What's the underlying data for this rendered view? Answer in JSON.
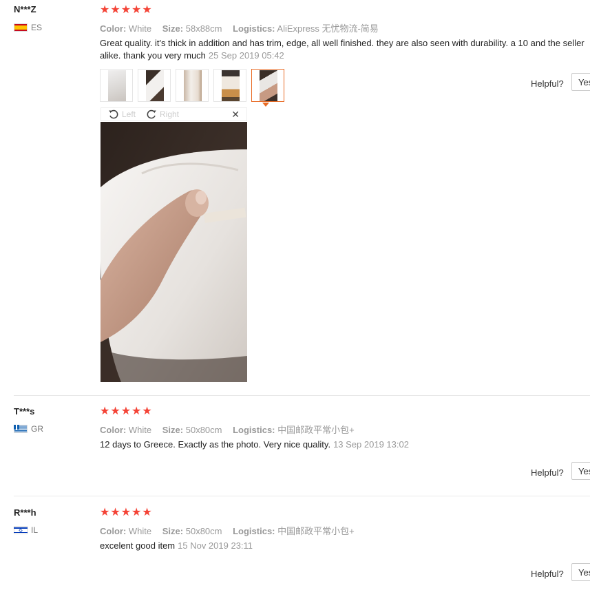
{
  "labels": {
    "color": "Color:",
    "size": "Size:",
    "logistics": "Logistics:",
    "helpful": "Helpful?",
    "yes": "Yes"
  },
  "stars_display": "★★★★★",
  "reviews": [
    {
      "user": "N***Z",
      "country": "ES",
      "rating": 5,
      "color": "White",
      "size": "58x88cm",
      "logistics": "AliExpress 无忧物流-简易",
      "text": "Great quality. it's thick in addition and has trim, edge, all well finished. they are also seen with durability. a 10 and the seller alike. thank you very much",
      "date": "25 Sep 2019 05:42",
      "photo_count": 5,
      "active_photo": 5,
      "viewer": {
        "left": "Left",
        "right": "Right"
      }
    },
    {
      "user": "T***s",
      "country": "GR",
      "rating": 5,
      "color": "White",
      "size": "50x80cm",
      "logistics": "中国邮政平常小包+",
      "text": "12 days to Greece. Exactly as the photo. Very nice quality.",
      "date": "13 Sep 2019 13:02"
    },
    {
      "user": "R***h",
      "country": "IL",
      "rating": 5,
      "color": "White",
      "size": "50x80cm",
      "logistics": "中国邮政平常小包+",
      "text": "excelent good item",
      "date": "15 Nov 2019 23:11"
    }
  ],
  "colors": {
    "stars": "#f44336",
    "active_thumb": "#e96a23",
    "muted_text": "#999999"
  }
}
